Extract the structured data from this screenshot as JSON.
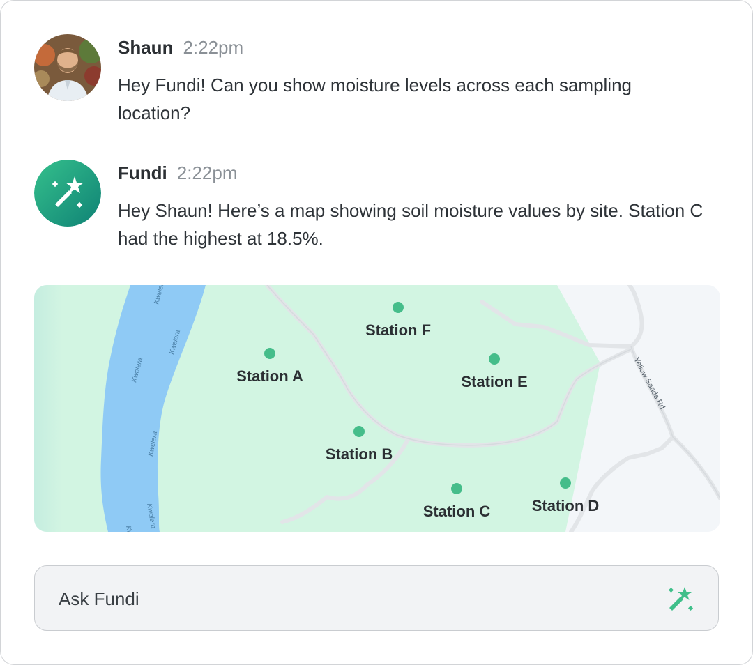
{
  "messages": [
    {
      "sender": "Shaun",
      "time": "2:22pm",
      "text": "Hey Fundi! Can you show moisture levels across each sampling location?",
      "avatar_icon": "user-photo"
    },
    {
      "sender": "Fundi",
      "time": "2:22pm",
      "text": "Hey Shaun! Here’s a map showing soil moisture values by site. Station C had the highest at 18.5%.",
      "avatar_icon": "magic-wand-icon"
    }
  ],
  "map": {
    "river_label": "Kwelera",
    "road_label": "Yellow Sands Rd.",
    "stations": [
      {
        "label": "Station F"
      },
      {
        "label": "Station A"
      },
      {
        "label": "Station E"
      },
      {
        "label": "Station B"
      },
      {
        "label": "Station C"
      },
      {
        "label": "Station D"
      }
    ],
    "colors": {
      "land": "#d2f5e2",
      "water": "#8fcaf5",
      "background": "#f3f6f9",
      "marker": "#45bd8a",
      "road": "#e2e5e8"
    }
  },
  "input": {
    "placeholder": "Ask Fundi",
    "submit_icon": "magic-wand-icon"
  },
  "brand_color": "#1c9d7e"
}
